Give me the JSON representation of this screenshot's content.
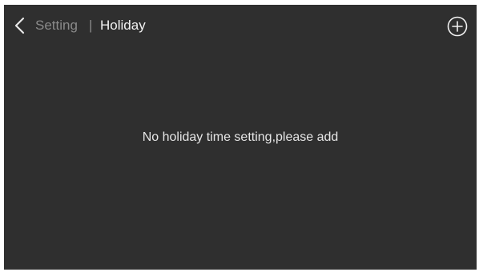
{
  "header": {
    "back_icon": "chevron-left-icon",
    "parent_label": "Setting",
    "separator": "|",
    "title": "Holiday",
    "add_icon": "circle-plus-icon"
  },
  "main": {
    "empty_message": "No holiday time setting,please add"
  },
  "colors": {
    "background": "#2f2f2f",
    "text_primary": "#f2f2f2",
    "text_muted": "#8a8a8a"
  }
}
